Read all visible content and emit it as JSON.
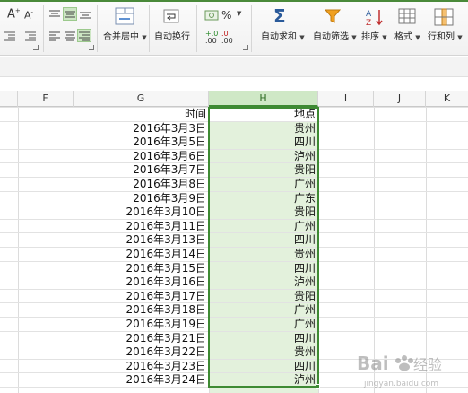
{
  "ribbon": {
    "merge_center_label": "合并居中",
    "wrap_text_label": "自动换行",
    "autosum_label": "自动求和",
    "autofilter_label": "自动筛选",
    "sort_label": "排序",
    "format_label": "格式",
    "rows_cols_label": "行和列",
    "percent_symbol": "%",
    "increase_decimal": ".00",
    "decrease_decimal": ".00"
  },
  "columns": [
    "F",
    "G",
    "H",
    "I",
    "J",
    "K"
  ],
  "selected_column": "H",
  "rows": [
    {
      "g": "时间",
      "h": "地点"
    },
    {
      "g": "2016年3月3日",
      "h": "贵州"
    },
    {
      "g": "2016年3月5日",
      "h": "四川"
    },
    {
      "g": "2016年3月6日",
      "h": "泸州"
    },
    {
      "g": "2016年3月7日",
      "h": "贵阳"
    },
    {
      "g": "2016年3月8日",
      "h": "广州"
    },
    {
      "g": "2016年3月9日",
      "h": "广东"
    },
    {
      "g": "2016年3月10日",
      "h": "贵阳"
    },
    {
      "g": "2016年3月11日",
      "h": "广州"
    },
    {
      "g": "2016年3月13日",
      "h": "四川"
    },
    {
      "g": "2016年3月14日",
      "h": "贵州"
    },
    {
      "g": "2016年3月15日",
      "h": "四川"
    },
    {
      "g": "2016年3月16日",
      "h": "泸州"
    },
    {
      "g": "2016年3月17日",
      "h": "贵阳"
    },
    {
      "g": "2016年3月18日",
      "h": "广州"
    },
    {
      "g": "2016年3月19日",
      "h": "广州"
    },
    {
      "g": "2016年3月21日",
      "h": "四川"
    },
    {
      "g": "2016年3月22日",
      "h": "贵州"
    },
    {
      "g": "2016年3月23日",
      "h": "四川"
    },
    {
      "g": "2016年3月24日",
      "h": "泸州"
    }
  ],
  "colors": {
    "selection_border": "#3e8a33",
    "selection_fill": "#e3f1dc",
    "header_selected_fill": "#cfe8c6"
  },
  "watermark": {
    "text": "Baidu 经验",
    "url_text": "jingyan.baidu.com"
  }
}
